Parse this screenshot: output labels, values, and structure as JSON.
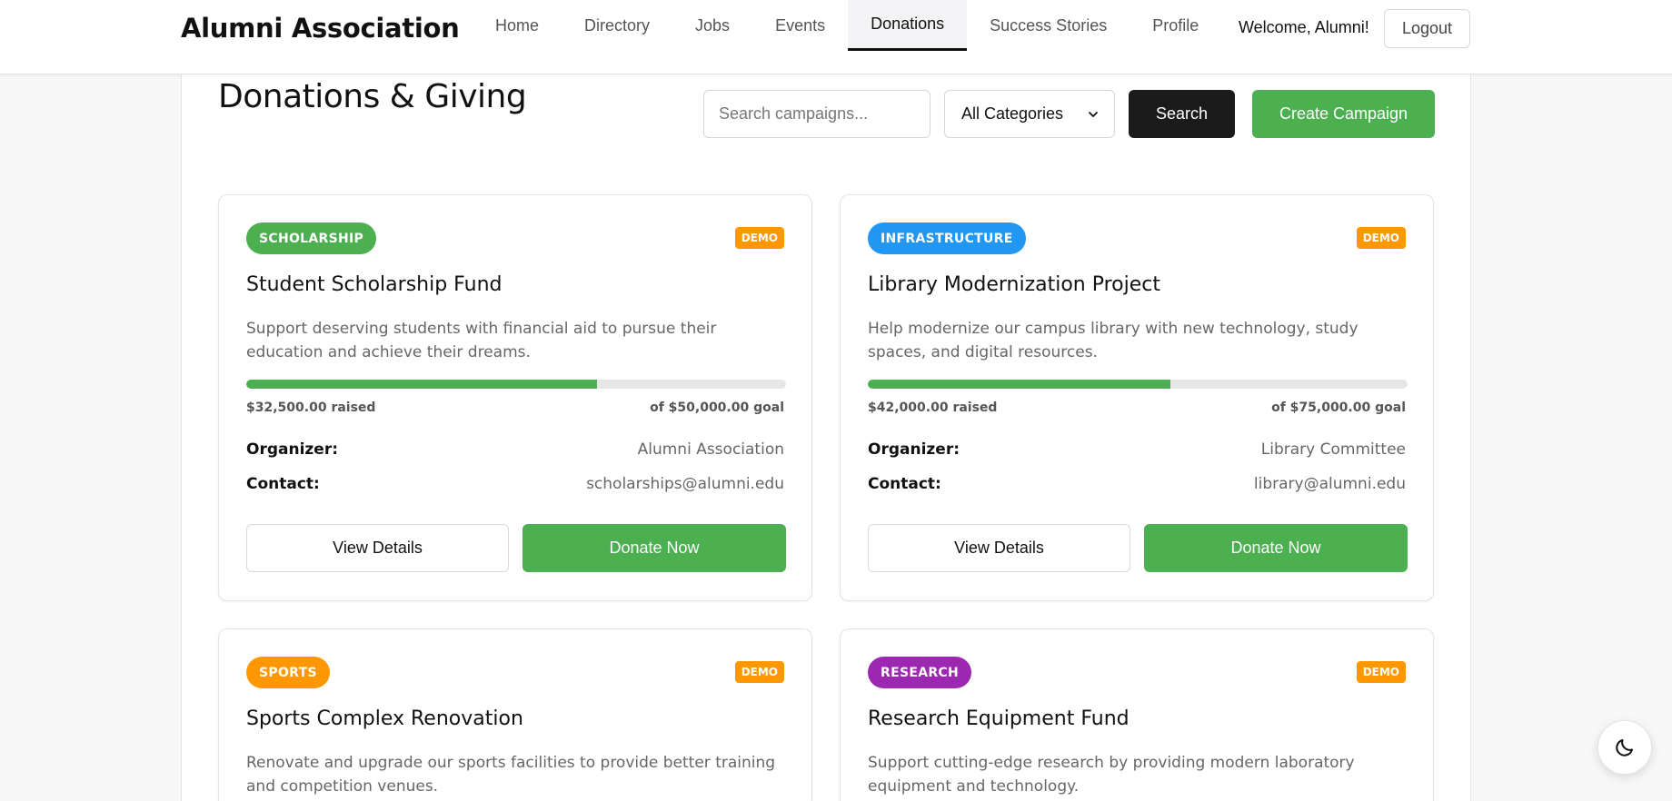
{
  "header": {
    "brand": "Alumni Association",
    "nav": [
      {
        "label": "Home",
        "active": false
      },
      {
        "label": "Directory",
        "active": false
      },
      {
        "label": "Jobs",
        "active": false
      },
      {
        "label": "Events",
        "active": false
      },
      {
        "label": "Donations",
        "active": true
      },
      {
        "label": "Success Stories",
        "active": false
      },
      {
        "label": "Profile",
        "active": false
      }
    ],
    "welcome": "Welcome, Alumni!",
    "logout_label": "Logout"
  },
  "page": {
    "title": "Donations & Giving",
    "search_placeholder": "Search campaigns...",
    "category_selected": "All Categories",
    "search_label": "Search",
    "create_label": "Create Campaign"
  },
  "campaigns": [
    {
      "category": "SCHOLARSHIP",
      "category_color": "#4caf50",
      "demo_label": "DEMO",
      "title": "Student Scholarship Fund",
      "description": "Support deserving students with financial aid to pursue their education and achieve their dreams.",
      "progress": 0.65,
      "raised": "$32,500.00 raised",
      "goal": "of $50,000.00 goal",
      "organizer_label": "Organizer:",
      "organizer": "Alumni Association",
      "contact_label": "Contact:",
      "contact": "scholarships@alumni.edu",
      "details_label": "View Details",
      "donate_label": "Donate Now"
    },
    {
      "category": "INFRASTRUCTURE",
      "category_color": "#2196f3",
      "demo_label": "DEMO",
      "title": "Library Modernization Project",
      "description": "Help modernize our campus library with new technology, study spaces, and digital resources.",
      "progress": 0.56,
      "raised": "$42,000.00 raised",
      "goal": "of $75,000.00 goal",
      "organizer_label": "Organizer:",
      "organizer": "Library Committee",
      "contact_label": "Contact:",
      "contact": "library@alumni.edu",
      "details_label": "View Details",
      "donate_label": "Donate Now"
    },
    {
      "category": "SPORTS",
      "category_color": "#ff9800",
      "demo_label": "DEMO",
      "title": "Sports Complex Renovation",
      "description": "Renovate and upgrade our sports facilities to provide better training and competition venues."
    },
    {
      "category": "RESEARCH",
      "category_color": "#9c27b0",
      "demo_label": "DEMO",
      "title": "Research Equipment Fund",
      "description": "Support cutting-edge research by providing modern laboratory equipment and technology."
    }
  ],
  "icons": {
    "theme_toggle": "moon-icon",
    "select_arrow": "chevron-down-icon"
  }
}
